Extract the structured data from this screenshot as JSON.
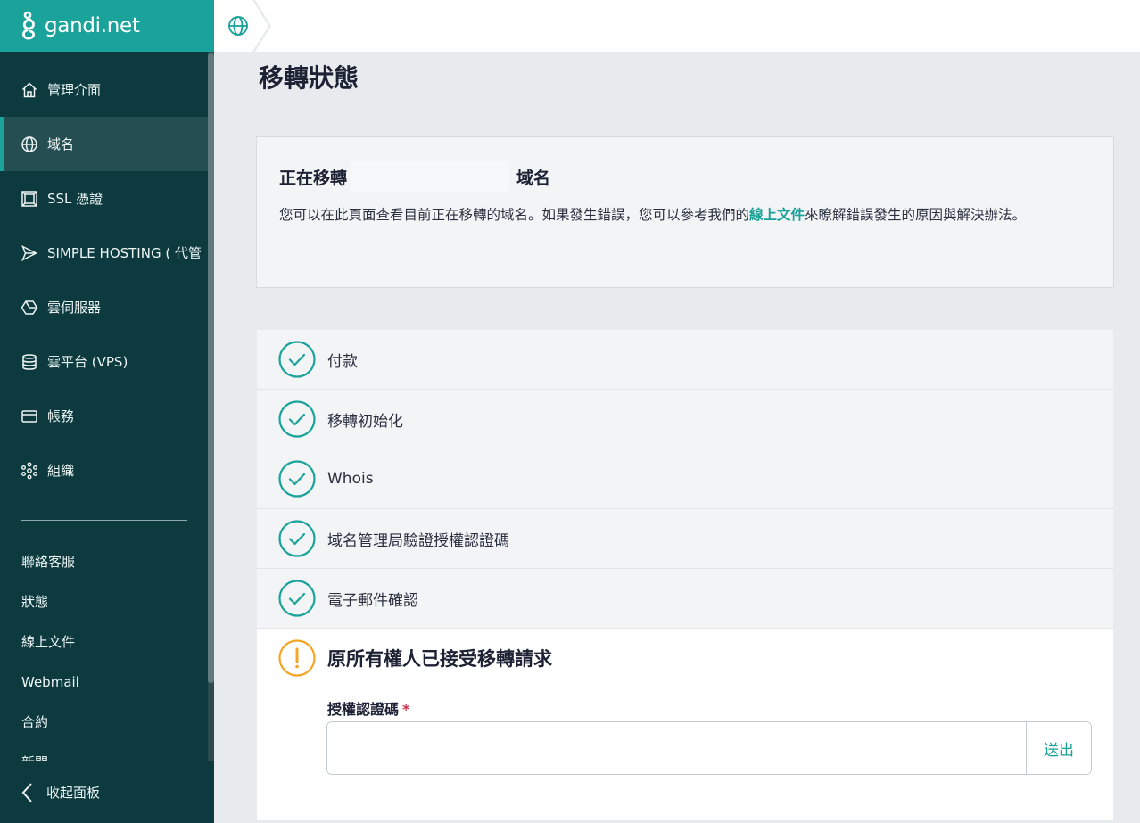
{
  "brand": {
    "name": "gandi.net"
  },
  "sidebar": {
    "items": [
      {
        "label": "管理介面",
        "icon": "home-icon",
        "active": false
      },
      {
        "label": "域名",
        "icon": "globe-icon",
        "active": true
      },
      {
        "label": "SSL 憑證",
        "icon": "certificate-icon",
        "active": false
      },
      {
        "label": "SIMPLE HOSTING ( 代管",
        "icon": "send-icon",
        "active": false
      },
      {
        "label": "雲伺服器",
        "icon": "hexagon-icon",
        "active": false
      },
      {
        "label": "雲平台 (VPS)",
        "icon": "server-icon",
        "active": false
      },
      {
        "label": "帳務",
        "icon": "credit-card-icon",
        "active": false
      },
      {
        "label": "組織",
        "icon": "network-icon",
        "active": false
      }
    ],
    "links": [
      "聯絡客服",
      "狀態",
      "線上文件",
      "Webmail",
      "合約",
      "新聞"
    ],
    "collapse_label": "收起面板"
  },
  "topbar": {
    "breadcrumb_icon": "globe-icon"
  },
  "page": {
    "title": "移轉狀態",
    "info": {
      "title_prefix": "正在移轉",
      "title_suffix": "域名",
      "desc_before": "您可以在此頁面查看目前正在移轉的域名。如果發生錯誤，您可以參考我們的",
      "desc_link": "線上文件",
      "desc_after": "來瞭解錯誤發生的原因與解決辦法。"
    },
    "steps": [
      {
        "label": "付款",
        "status": "done"
      },
      {
        "label": "移轉初始化",
        "status": "done"
      },
      {
        "label": "Whois",
        "status": "done"
      },
      {
        "label": "域名管理局驗證授權認證碼",
        "status": "done"
      },
      {
        "label": "電子郵件確認",
        "status": "done"
      }
    ],
    "pending_step": {
      "label": "原所有權人已接受移轉請求",
      "status": "warning",
      "field_label": "授權認證碼",
      "required_mark": "*",
      "input_value": "",
      "submit_label": "送出"
    }
  },
  "colors": {
    "accent": "#1aa39b",
    "sidebar_bg": "#0c3a3e",
    "warning": "#f5a524",
    "required": "#d2334c"
  }
}
